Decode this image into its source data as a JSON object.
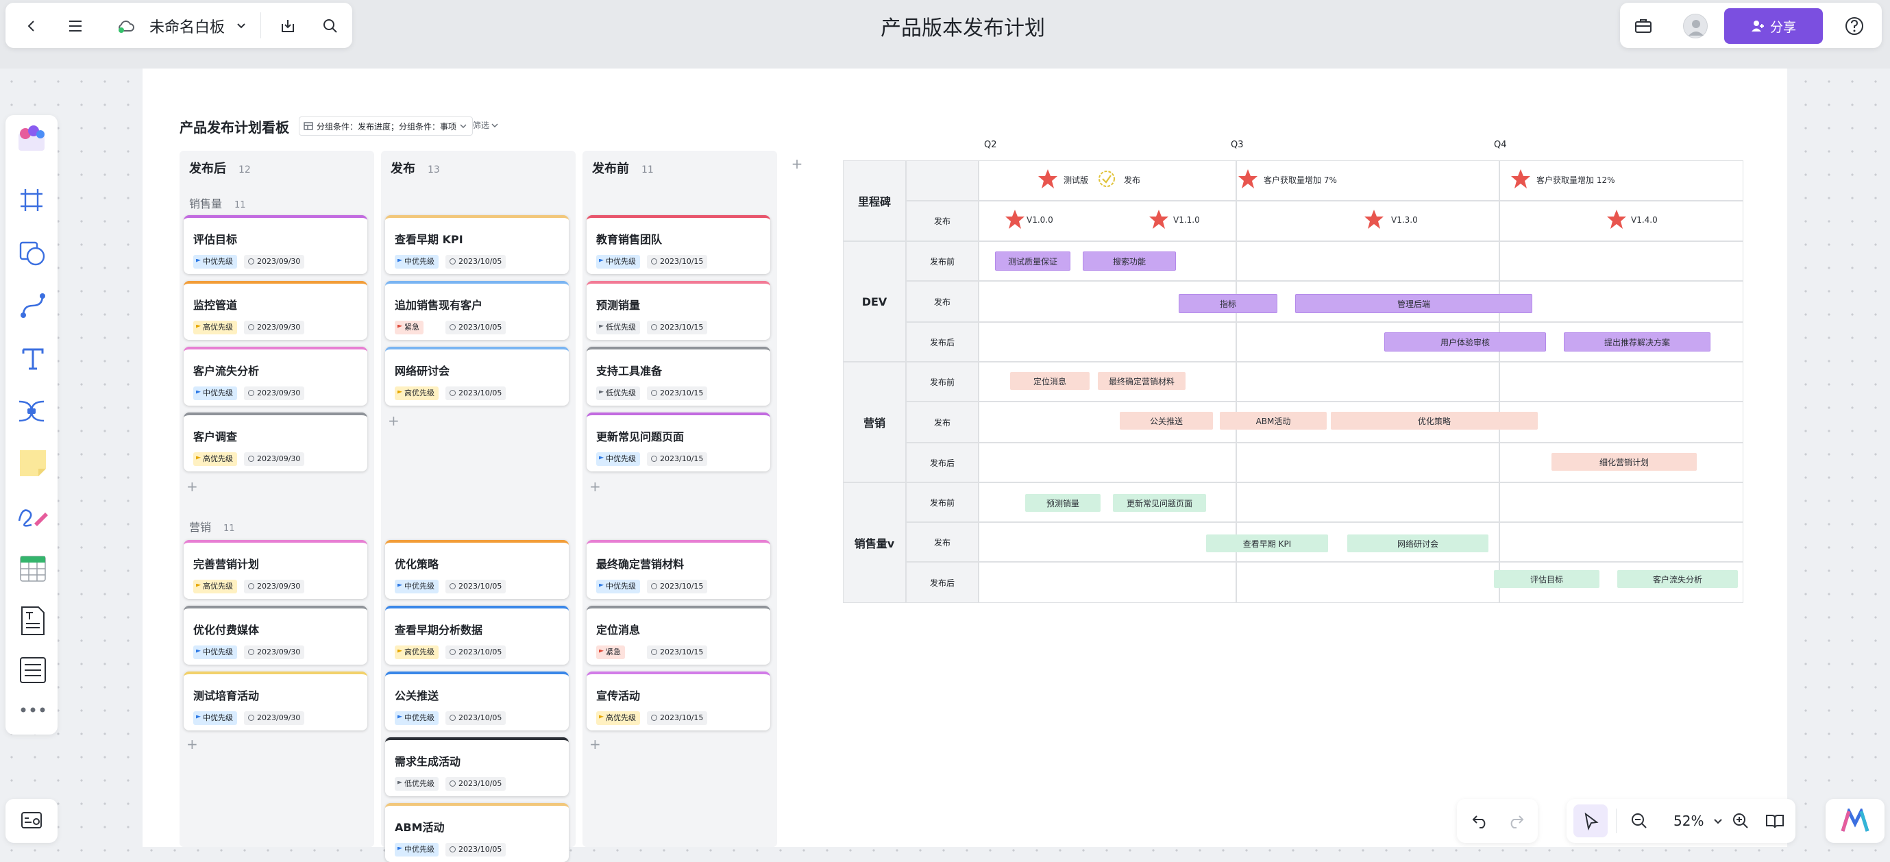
{
  "topbar": {
    "board_name": "未命名白板",
    "page_title": "产品版本发布计划",
    "share_label": "分享"
  },
  "board": {
    "title": "产品发布计划看板",
    "group_condition": "分组条件：发布进度；分组条件：事项",
    "filter": "筛选",
    "columns": [
      {
        "name": "发布后",
        "count": "12"
      },
      {
        "name": "发布",
        "count": "13"
      },
      {
        "name": "发布前",
        "count": "11"
      }
    ],
    "groups": [
      {
        "name": "销售量",
        "count": "11"
      },
      {
        "name": "营销",
        "count": "11"
      }
    ],
    "priorities": {
      "mid": "中优先级",
      "high": "高优先级",
      "low": "低优先级",
      "urgent": "紧急"
    },
    "cards": {
      "c1": [
        {
          "title": "评估目标",
          "pri": "中优先级",
          "date": "2023/09/30"
        },
        {
          "title": "监控管道",
          "pri": "高优先级",
          "date": "2023/09/30"
        },
        {
          "title": "客户流失分析",
          "pri": "中优先级",
          "date": "2023/09/30"
        },
        {
          "title": "客户调查",
          "pri": "高优先级",
          "date": "2023/09/30"
        },
        {
          "title": "完善营销计划",
          "pri": "高优先级",
          "date": "2023/09/30"
        },
        {
          "title": "优化付费媒体",
          "pri": "中优先级",
          "date": "2023/09/30"
        },
        {
          "title": "测试培育活动",
          "pri": "中优先级",
          "date": "2023/09/30"
        }
      ],
      "c2": [
        {
          "title": "查看早期 KPI",
          "pri": "中优先级",
          "date": "2023/10/05"
        },
        {
          "title": "追加销售现有客户",
          "pri": "紧急",
          "date": "2023/10/05"
        },
        {
          "title": "网络研讨会",
          "pri": "高优先级",
          "date": "2023/10/05"
        },
        {
          "title": "优化策略",
          "pri": "中优先级",
          "date": "2023/10/05"
        },
        {
          "title": "查看早期分析数据",
          "pri": "高优先级",
          "date": "2023/10/05"
        },
        {
          "title": "公关推送",
          "pri": "中优先级",
          "date": "2023/10/05"
        },
        {
          "title": "需求生成活动",
          "pri": "低优先级",
          "date": "2023/10/05"
        },
        {
          "title": "ABM活动",
          "pri": "中优先级",
          "date": "2023/10/05"
        }
      ],
      "c3": [
        {
          "title": "教育销售团队",
          "pri": "中优先级",
          "date": "2023/10/15"
        },
        {
          "title": "预测销量",
          "pri": "低优先级",
          "date": "2023/10/15"
        },
        {
          "title": "支持工具准备",
          "pri": "低优先级",
          "date": "2023/10/15"
        },
        {
          "title": "更新常见问题页面",
          "pri": "中优先级",
          "date": "2023/10/15"
        },
        {
          "title": "最终确定营销材料",
          "pri": "中优先级",
          "date": "2023/10/15"
        },
        {
          "title": "定位消息",
          "pri": "紧急",
          "date": "2023/10/15"
        },
        {
          "title": "宣传活动",
          "pri": "高优先级",
          "date": "2023/10/15"
        }
      ]
    }
  },
  "gantt": {
    "quarters": [
      "Q2",
      "Q3",
      "Q4"
    ],
    "groups": [
      "里程碑",
      "DEV",
      "营销",
      "销售量v"
    ],
    "row_labels": [
      "发布",
      "发布前",
      "发布",
      "发布后",
      "发布前",
      "发布",
      "发布后",
      "发布前",
      "发布",
      "发布后"
    ],
    "milestones": [
      "测试版",
      "发布",
      "客户获取量增加 7%",
      "客户获取量增加 12%"
    ],
    "versions": [
      "V1.0.0",
      "V1.1.0",
      "V1.3.0",
      "V1.4.0"
    ],
    "bars": {
      "dev": [
        "测试质量保证",
        "搜索功能",
        "指标",
        "管理后端",
        "用户体验审核",
        "提出推荐解决方案"
      ],
      "mkt": [
        "定位消息",
        "最终确定营销材料",
        "公关推送",
        "ABM活动",
        "优化策略",
        "细化营销计划"
      ],
      "sales": [
        "预测销量",
        "更新常见问题页面",
        "查看早期 KPI",
        "网络研讨会",
        "评估目标",
        "客户流失分析"
      ]
    }
  },
  "zoom": {
    "level": "52%"
  },
  "colors": {
    "accent": "#7b4fe0",
    "purple_bar": "#c8a6f2",
    "orange_bar": "#fadcd4",
    "green_bar": "#d2f1e0",
    "milestone_star": "#e8554e"
  }
}
